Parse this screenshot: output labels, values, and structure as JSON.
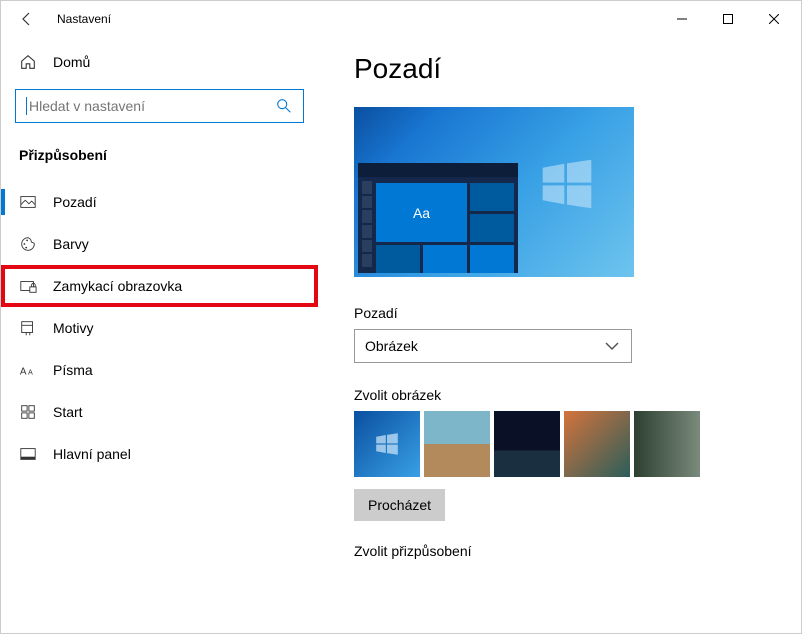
{
  "titlebar": {
    "title": "Nastavení"
  },
  "home": {
    "label": "Domů"
  },
  "search": {
    "placeholder": "Hledat v nastavení"
  },
  "section": {
    "label": "Přizpůsobení"
  },
  "nav": {
    "pozadi": "Pozadí",
    "barvy": "Barvy",
    "zamykaci": "Zamykací obrazovka",
    "motivy": "Motivy",
    "pisma": "Písma",
    "start": "Start",
    "hlavni_panel": "Hlavní panel"
  },
  "content": {
    "heading": "Pozadí",
    "sample_text": "Aa",
    "bg_label": "Pozadí",
    "bg_value": "Obrázek",
    "choose_label": "Zvolit obrázek",
    "browse": "Procházet",
    "fit_label": "Zvolit přizpůsobení"
  }
}
